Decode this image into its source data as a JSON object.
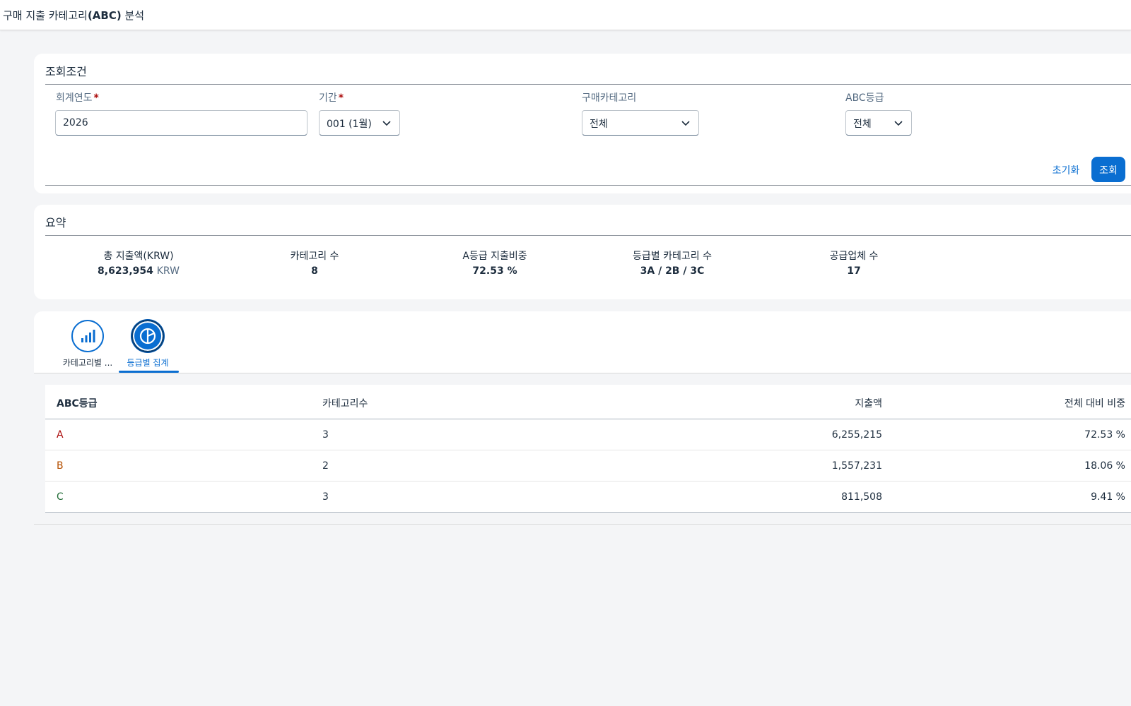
{
  "header": {
    "title_prefix": "구매 지출 카테고리",
    "title_bold": "(ABC)",
    "title_suffix": " 분석"
  },
  "filter": {
    "title": "조회조건",
    "fiscal_year": {
      "label": "회계연도",
      "value": "2026"
    },
    "period": {
      "label": "기간",
      "value": "001 (1월)"
    },
    "category": {
      "label": "구매카테고리",
      "value": "전체"
    },
    "abc_grade": {
      "label": "ABC등급",
      "value": "전체"
    },
    "required_mark": "*",
    "reset_label": "초기화",
    "search_label": "조회"
  },
  "summary": {
    "title": "요약",
    "kpis": [
      {
        "label": "총 지출액(KRW)",
        "value": "8,623,954",
        "unit": "KRW"
      },
      {
        "label": "카테고리 수",
        "value": "8"
      },
      {
        "label": "A등급 지출비중",
        "value": "72.53 %"
      },
      {
        "label": "등급별 카테고리 수",
        "value": "3A / 2B / 3C"
      },
      {
        "label": "공급업체 수",
        "value": "17"
      }
    ]
  },
  "tabs": [
    {
      "label": "카테고리별 ...",
      "icon": "bar-chart-icon"
    },
    {
      "label": "등급별 집계",
      "icon": "pie-chart-icon",
      "active": true
    }
  ],
  "table": {
    "columns": [
      "ABC등급",
      "카테고리수",
      "지출액",
      "전체 대비 비중"
    ],
    "rows": [
      {
        "grade": "A",
        "count": "3",
        "amount": "6,255,215",
        "share": "72.53 %",
        "color": "#aa0808"
      },
      {
        "grade": "B",
        "count": "2",
        "amount": "1,557,231",
        "share": "18.06 %",
        "color": "#b44f00"
      },
      {
        "grade": "C",
        "count": "3",
        "amount": "811,508",
        "share": "9.41 %",
        "color": "#256f3a"
      }
    ]
  },
  "colors": {
    "accent": "#0a6ed1",
    "grade_a": "#aa0808",
    "grade_b": "#b44f00",
    "grade_c": "#256f3a"
  }
}
